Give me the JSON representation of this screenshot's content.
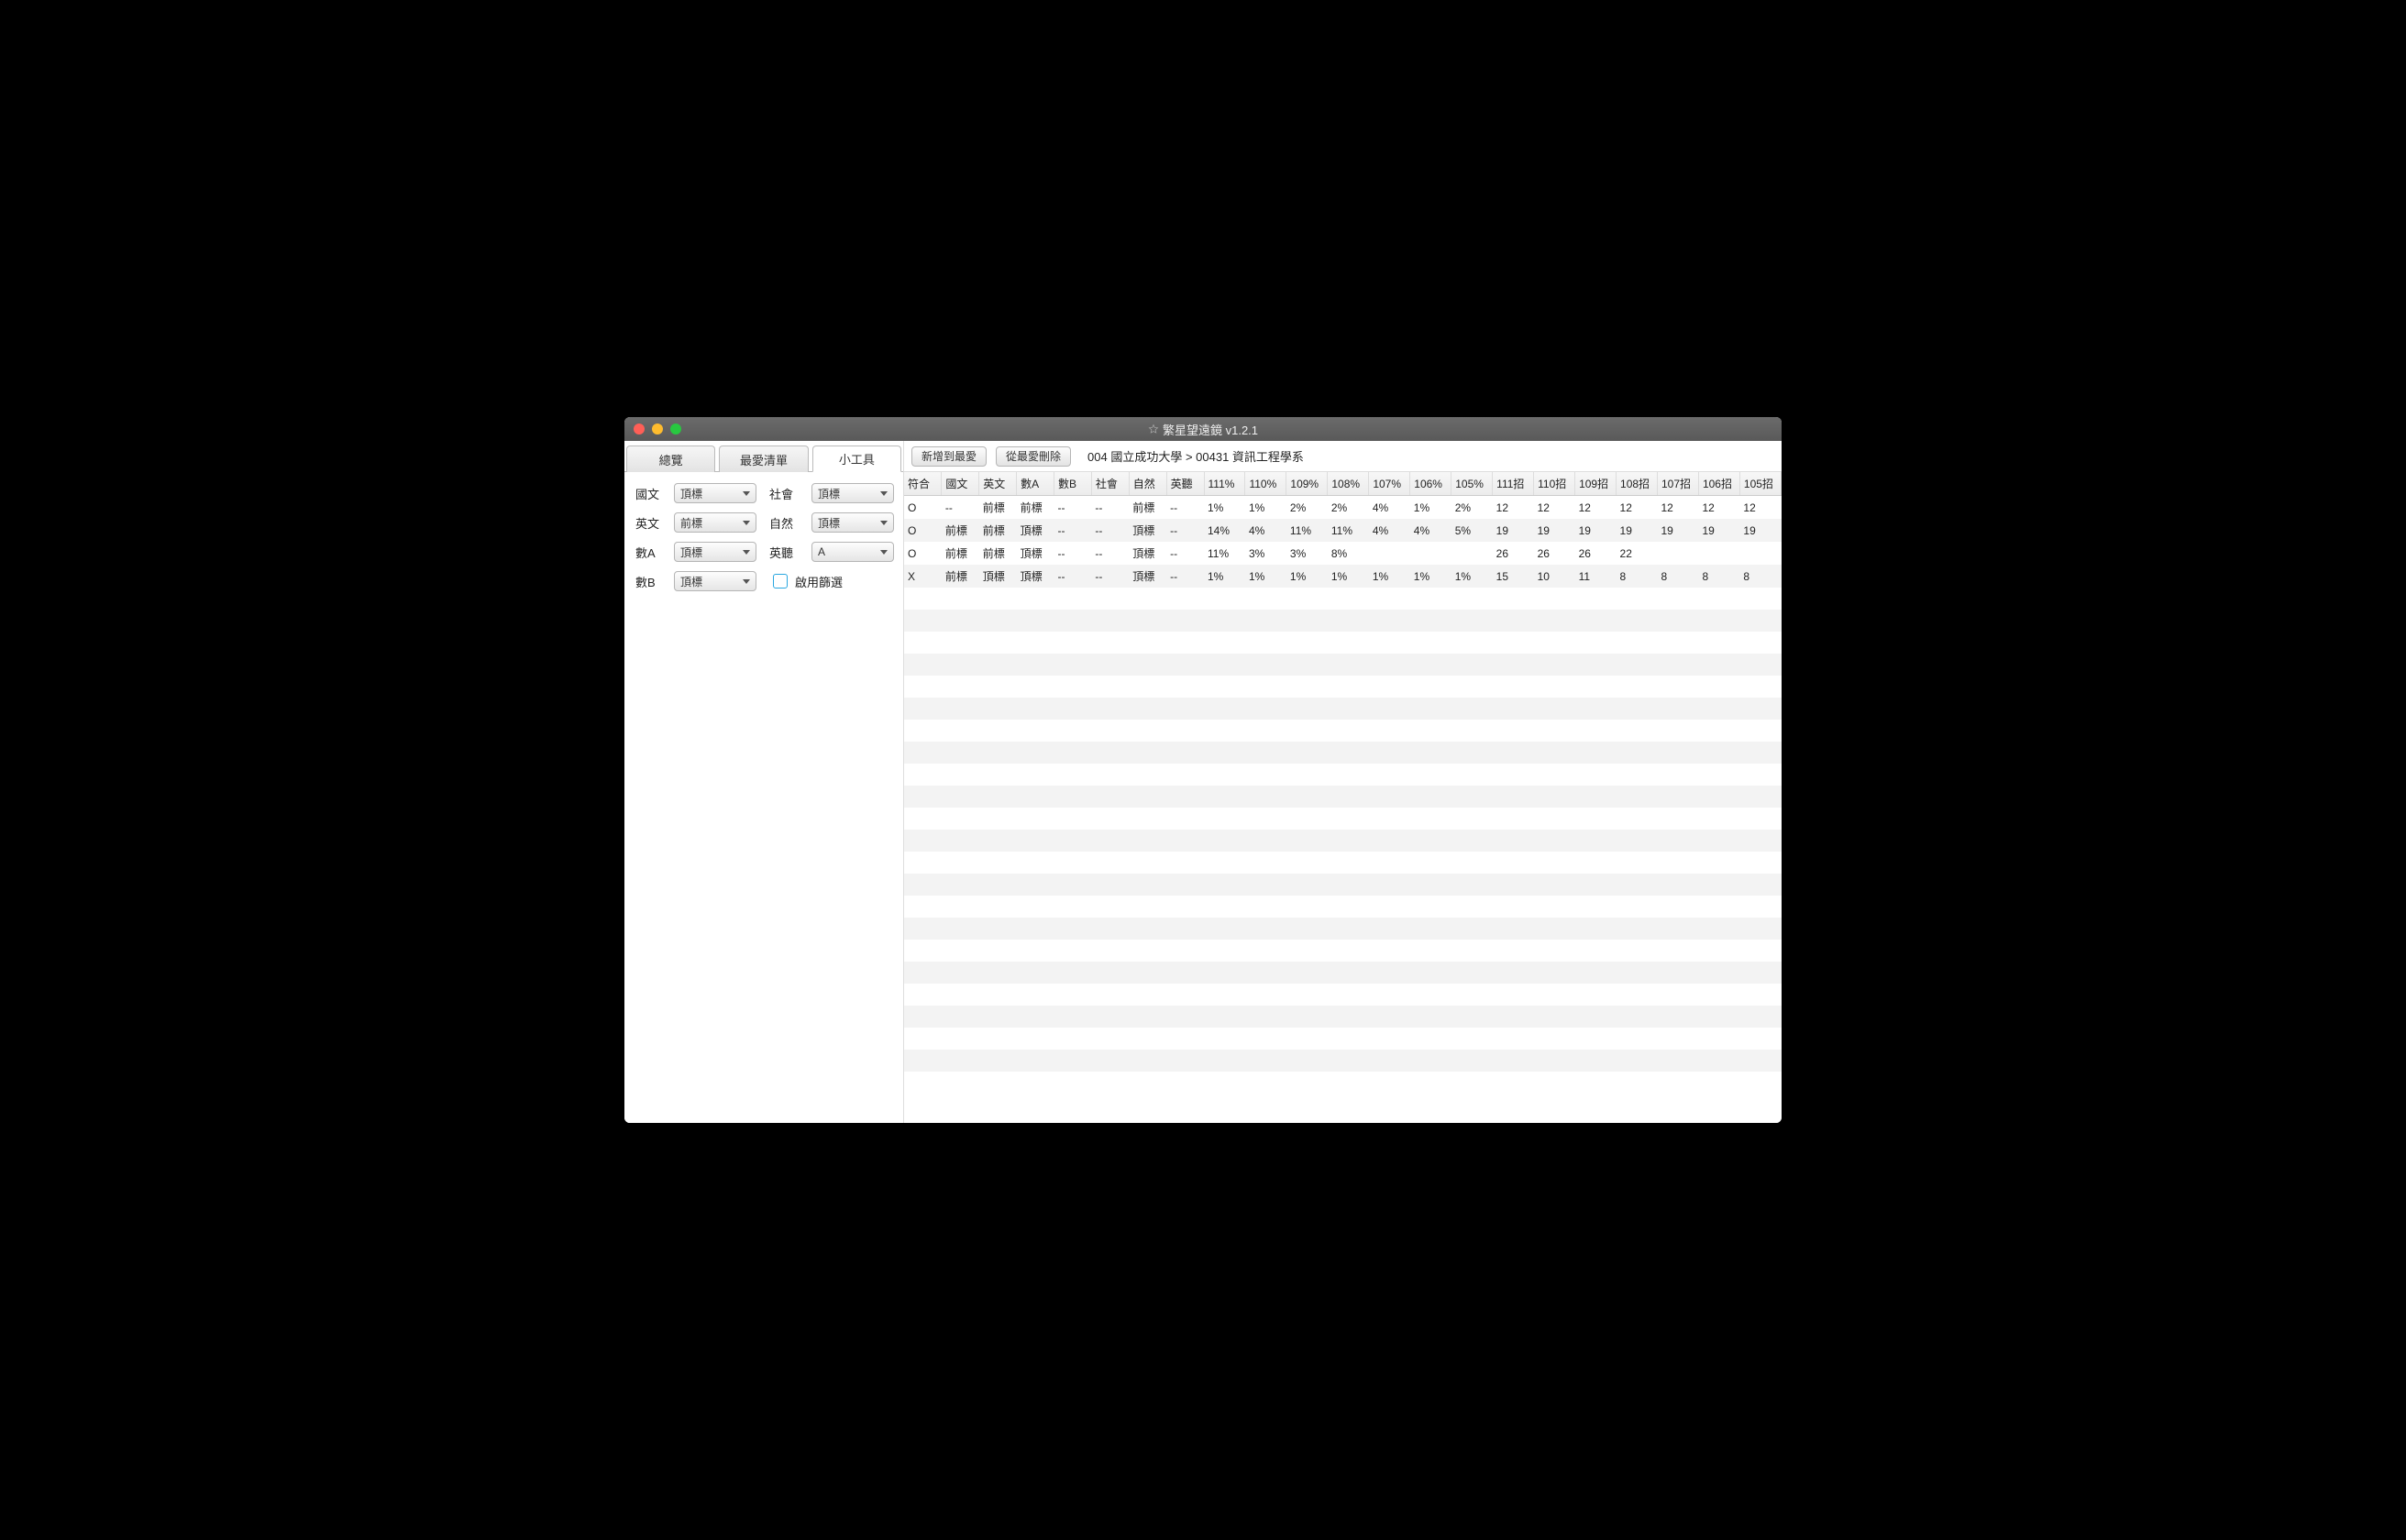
{
  "window": {
    "title": "繁星望遠鏡 v1.2.1"
  },
  "tabs": [
    {
      "label": "總覽"
    },
    {
      "label": "最愛清單"
    },
    {
      "label": "小工具",
      "active": true
    }
  ],
  "filters": {
    "chinese": {
      "label": "國文",
      "value": "頂標"
    },
    "english": {
      "label": "英文",
      "value": "前標"
    },
    "mathA": {
      "label": "數A",
      "value": "頂標"
    },
    "mathB": {
      "label": "數B",
      "value": "頂標"
    },
    "social": {
      "label": "社會",
      "value": "頂標"
    },
    "nature": {
      "label": "自然",
      "value": "頂標"
    },
    "listening": {
      "label": "英聽",
      "value": "A"
    },
    "enable": {
      "label": "啟用篩選",
      "checked": false
    }
  },
  "toolbar": {
    "add_fav": "新增到最愛",
    "del_fav": "從最愛刪除",
    "breadcrumb": "004 國立成功大學 > 00431 資訊工程學系"
  },
  "columns": [
    "符合",
    "國文",
    "英文",
    "數A",
    "數B",
    "社會",
    "自然",
    "英聽",
    "111%",
    "110%",
    "109%",
    "108%",
    "107%",
    "106%",
    "105%",
    "111招",
    "110招",
    "109招",
    "108招",
    "107招",
    "106招",
    "105招"
  ],
  "rows": [
    [
      "O",
      "--",
      "前標",
      "前標",
      "--",
      "--",
      "前標",
      "--",
      "1%",
      "1%",
      "2%",
      "2%",
      "4%",
      "1%",
      "2%",
      "12",
      "12",
      "12",
      "12",
      "12",
      "12",
      "12"
    ],
    [
      "O",
      "前標",
      "前標",
      "頂標",
      "--",
      "--",
      "頂標",
      "--",
      "14%",
      "4%",
      "11%",
      "11%",
      "4%",
      "4%",
      "5%",
      "19",
      "19",
      "19",
      "19",
      "19",
      "19",
      "19"
    ],
    [
      "O",
      "前標",
      "前標",
      "頂標",
      "--",
      "--",
      "頂標",
      "--",
      "11%",
      "3%",
      "3%",
      "8%",
      "",
      "",
      "",
      "26",
      "26",
      "26",
      "22",
      "",
      "",
      ""
    ],
    [
      "X",
      "前標",
      "頂標",
      "頂標",
      "--",
      "--",
      "頂標",
      "--",
      "1%",
      "1%",
      "1%",
      "1%",
      "1%",
      "1%",
      "1%",
      "15",
      "10",
      "11",
      "8",
      "8",
      "8",
      "8"
    ]
  ],
  "empty_rows": 22
}
